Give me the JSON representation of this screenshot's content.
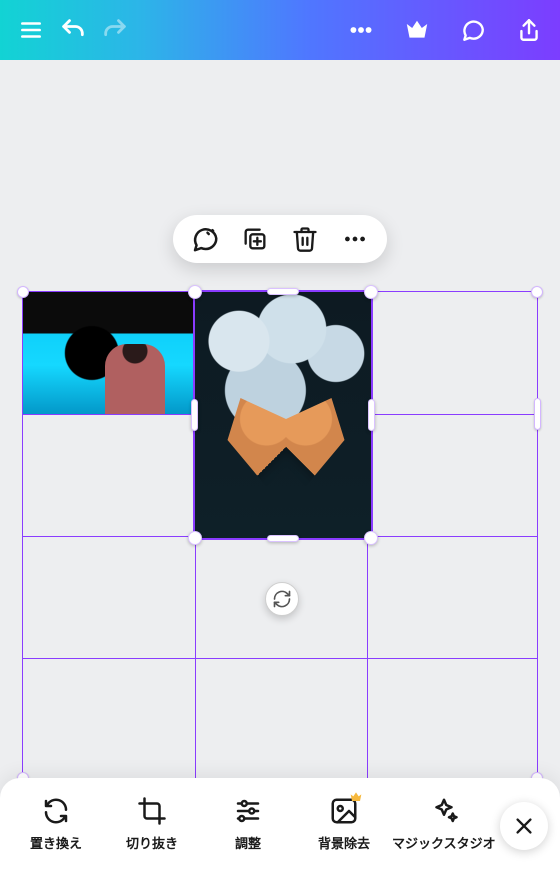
{
  "header": {
    "icons": {
      "menu": "menu-icon",
      "undo": "undo-icon",
      "redo": "redo-icon",
      "more": "more-icon",
      "pro": "crown-icon",
      "chat": "chat-icon",
      "share": "share-icon"
    }
  },
  "contextPill": {
    "icons": {
      "ai": "ai-chat-icon",
      "duplicate": "duplicate-icon",
      "delete": "trash-icon",
      "more": "more-icon"
    }
  },
  "canvas": {
    "grid": {
      "rows": 4,
      "cols": 3
    },
    "photos": [
      {
        "id": "p1",
        "slot": "r0c0",
        "desc": "child-silhouette-aquarium"
      },
      {
        "id": "p2",
        "slot": "r0c1-span2",
        "desc": "hands-heart-jellyfish",
        "selected": true
      }
    ],
    "rotateIcon": "rotate-icon"
  },
  "toolbar": {
    "items": [
      {
        "name": "replace",
        "icon": "swap-icon",
        "label": "置き換え"
      },
      {
        "name": "crop",
        "icon": "crop-icon",
        "label": "切り抜き"
      },
      {
        "name": "adjust",
        "icon": "sliders-icon",
        "label": "調整"
      },
      {
        "name": "removebg",
        "icon": "removebg-icon",
        "label": "背景除去",
        "pro": true
      },
      {
        "name": "magic",
        "icon": "sparkle-icon",
        "label": "マジックスタジオ"
      }
    ],
    "closeIcon": "close-icon"
  },
  "colors": {
    "accent": "#8a3cff"
  }
}
